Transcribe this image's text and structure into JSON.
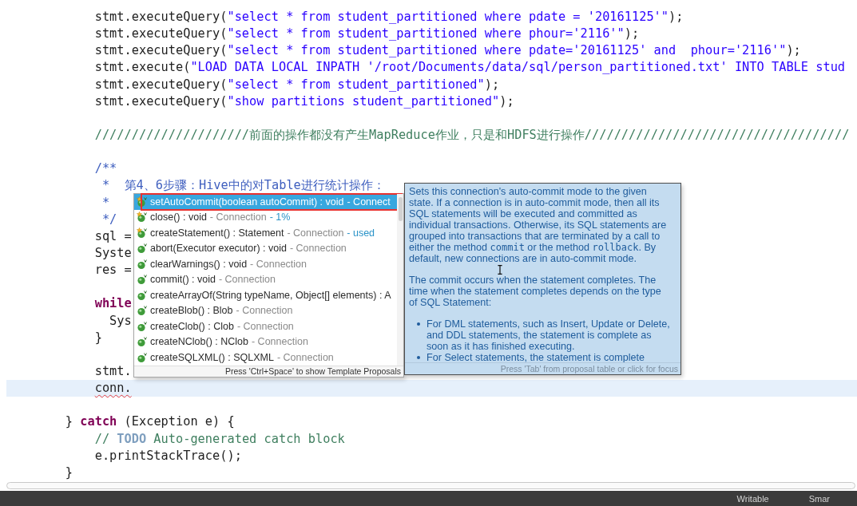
{
  "editor": {
    "lines": [
      {
        "kind": "code",
        "current": false,
        "tokens": [
          {
            "kind": "plain",
            "text": "        stmt.executeQuery("
          },
          {
            "kind": "string",
            "text": "\"select * from student_partitioned where pdate = '20161125'\""
          },
          {
            "kind": "plain",
            "text": ");"
          }
        ]
      },
      {
        "kind": "code",
        "current": false,
        "tokens": [
          {
            "kind": "plain",
            "text": "        stmt.executeQuery("
          },
          {
            "kind": "string",
            "text": "\"select * from student_partitioned where phour='2116'\""
          },
          {
            "kind": "plain",
            "text": ");"
          }
        ]
      },
      {
        "kind": "code",
        "current": false,
        "tokens": [
          {
            "kind": "plain",
            "text": "        stmt.executeQuery("
          },
          {
            "kind": "string",
            "text": "\"select * from student_partitioned where pdate='20161125' and  phour='2116'\""
          },
          {
            "kind": "plain",
            "text": ");"
          }
        ]
      },
      {
        "kind": "code",
        "current": false,
        "tokens": [
          {
            "kind": "plain",
            "text": "        stmt.execute("
          },
          {
            "kind": "string",
            "text": "\"LOAD DATA LOCAL INPATH '/root/Documents/data/sql/person_partitioned.txt' INTO TABLE stud"
          }
        ]
      },
      {
        "kind": "code",
        "current": false,
        "tokens": [
          {
            "kind": "plain",
            "text": "        stmt.executeQuery("
          },
          {
            "kind": "string",
            "text": "\"select * from student_partitioned\""
          },
          {
            "kind": "plain",
            "text": ");"
          }
        ]
      },
      {
        "kind": "code",
        "current": false,
        "tokens": [
          {
            "kind": "plain",
            "text": "        stmt.executeQuery("
          },
          {
            "kind": "string",
            "text": "\"show partitions student_partitioned\""
          },
          {
            "kind": "plain",
            "text": ");"
          }
        ]
      },
      {
        "kind": "blank",
        "current": false
      },
      {
        "kind": "code",
        "current": false,
        "tokens": [
          {
            "kind": "comment",
            "text": "        /////////////////////前面的操作都没有产生MapReduce作业，只是和HDFS进行操作////////////////////////////////////"
          }
        ]
      },
      {
        "kind": "blank",
        "current": false
      },
      {
        "kind": "code",
        "current": false,
        "tokens": [
          {
            "kind": "javadoc",
            "text": "        /**"
          }
        ]
      },
      {
        "kind": "code",
        "current": false,
        "tokens": [
          {
            "kind": "javadoc",
            "text": "         *  第4、6步骤：Hive中的对Table进行统计操作："
          }
        ]
      },
      {
        "kind": "code",
        "current": false,
        "tokens": [
          {
            "kind": "javadoc",
            "text": "         *"
          }
        ]
      },
      {
        "kind": "code",
        "current": false,
        "tokens": [
          {
            "kind": "javadoc",
            "text": "         */"
          }
        ]
      },
      {
        "kind": "code",
        "current": false,
        "tokens": [
          {
            "kind": "plain",
            "text": "        sql ="
          }
        ]
      },
      {
        "kind": "code",
        "current": false,
        "tokens": [
          {
            "kind": "plain",
            "text": "        Syste"
          }
        ]
      },
      {
        "kind": "code",
        "current": false,
        "tokens": [
          {
            "kind": "plain",
            "text": "        res ="
          }
        ]
      },
      {
        "kind": "blank",
        "current": false
      },
      {
        "kind": "code",
        "current": false,
        "tokens": [
          {
            "kind": "keyword",
            "text": "        while"
          }
        ]
      },
      {
        "kind": "code",
        "current": false,
        "tokens": [
          {
            "kind": "plain",
            "text": "          Sys"
          }
        ]
      },
      {
        "kind": "code",
        "current": false,
        "tokens": [
          {
            "kind": "plain",
            "text": "        }"
          }
        ]
      },
      {
        "kind": "blank",
        "current": false
      },
      {
        "kind": "code",
        "current": false,
        "tokens": [
          {
            "kind": "plain",
            "text": "        stmt."
          }
        ]
      },
      {
        "kind": "code",
        "current": true,
        "tokens": [
          {
            "kind": "error",
            "text": "        conn."
          }
        ]
      },
      {
        "kind": "blank",
        "current": false
      },
      {
        "kind": "code",
        "current": false,
        "tokens": [
          {
            "kind": "plain",
            "text": "    } "
          },
          {
            "kind": "keyword",
            "text": "catch"
          },
          {
            "kind": "plain",
            "text": " (Exception e) {"
          }
        ]
      },
      {
        "kind": "code",
        "current": false,
        "tokens": [
          {
            "kind": "comment",
            "text": "        // "
          },
          {
            "kind": "todo",
            "text": "TODO"
          },
          {
            "kind": "comment",
            "text": " Auto-generated catch block"
          }
        ]
      },
      {
        "kind": "code",
        "current": false,
        "tokens": [
          {
            "kind": "plain",
            "text": "        e.printStackTrace();"
          }
        ]
      },
      {
        "kind": "code",
        "current": false,
        "tokens": [
          {
            "kind": "plain",
            "text": "    }"
          }
        ]
      }
    ]
  },
  "proposals": {
    "items": [
      {
        "signature": "setAutoCommit(boolean autoCommit) : void",
        "owner": "- Connect",
        "selected": true,
        "outlined": true,
        "recommended": true
      },
      {
        "signature": "close() : void",
        "owner": "- Connection",
        "relevance": "- 1%",
        "selected": false,
        "outlined": false,
        "recommended": true
      },
      {
        "signature": "createStatement() : Statement",
        "owner": "- Connection",
        "relevance": "- used",
        "selected": false,
        "outlined": false,
        "recommended": true
      },
      {
        "signature": "abort(Executor executor) : void",
        "owner": "- Connection",
        "selected": false,
        "outlined": false,
        "recommended": false
      },
      {
        "signature": "clearWarnings() : void",
        "owner": "- Connection",
        "selected": false,
        "outlined": false,
        "recommended": false
      },
      {
        "signature": "commit() : void",
        "owner": "- Connection",
        "selected": false,
        "outlined": false,
        "recommended": false
      },
      {
        "signature": "createArrayOf(String typeName, Object[] elements) : A",
        "selected": false,
        "outlined": false,
        "recommended": false
      },
      {
        "signature": "createBlob() : Blob",
        "owner": "- Connection",
        "selected": false,
        "outlined": false,
        "recommended": false
      },
      {
        "signature": "createClob() : Clob",
        "owner": "- Connection",
        "selected": false,
        "outlined": false,
        "recommended": false
      },
      {
        "signature": "createNClob() : NClob",
        "owner": "- Connection",
        "selected": false,
        "outlined": false,
        "recommended": false
      },
      {
        "signature": "createSQLXML() : SQLXML",
        "owner": "- Connection",
        "selected": false,
        "outlined": false,
        "recommended": false
      }
    ],
    "hint": "Press 'Ctrl+Space' to show Template Proposals"
  },
  "doc": {
    "paragraphs": [
      [
        {
          "kind": "text",
          "text": "Sets this connection's auto-commit mode to the given\nstate. If a connection is in auto-commit mode, then all its\nSQL statements will be executed and committed as\nindividual transactions. Otherwise, its SQL statements are\ngrouped into transactions that are terminated by a call to\neither the method "
        },
        {
          "kind": "code",
          "text": "commit"
        },
        {
          "kind": "text",
          "text": " or the method "
        },
        {
          "kind": "code",
          "text": "rollback"
        },
        {
          "kind": "text",
          "text": ". By\ndefault, new connections are in auto-commit mode."
        }
      ],
      [
        {
          "kind": "text",
          "text": "The commit occurs when the statement completes. The\ntime when the statement completes depends on the type\nof SQL Statement:"
        }
      ]
    ],
    "bullets": [
      "For DML statements, such as Insert, Update or Delete,\nand DDL statements, the statement is complete as\nsoon as it has finished executing.",
      "For Select statements, the statement is complete"
    ],
    "hint": "Press 'Tab' from proposal table or click for focus"
  },
  "status_bar": {
    "items": [
      "Writable",
      "Smar"
    ]
  }
}
